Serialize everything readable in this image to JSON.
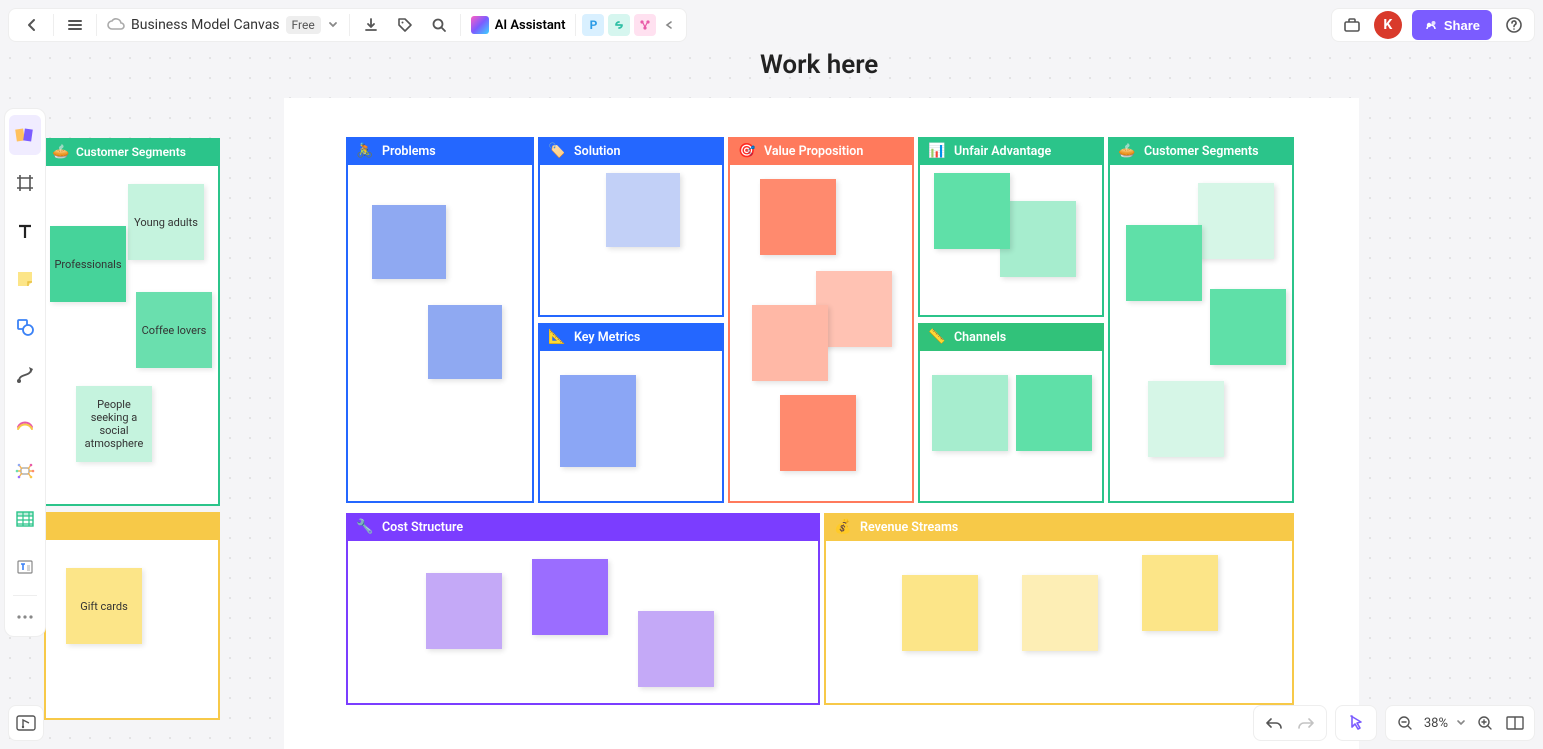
{
  "header": {
    "doc_title": "Business Model Canvas",
    "plan_badge": "Free",
    "ai_assistant_label": "AI Assistant",
    "p_icon_label": "P",
    "avatar_initial": "K",
    "share_label": "Share"
  },
  "canvas": {
    "title": "Work here"
  },
  "left_board": {
    "segments_header": "Customer Segments",
    "notes": {
      "young_adults": "Young adults",
      "professionals": "Professionals",
      "coffee_lovers": "Coffee lovers",
      "social_atmosphere": "People seeking a social atmosphere",
      "gift_cards": "Gift cards"
    }
  },
  "boards": {
    "problems": "Problems",
    "solution": "Solution",
    "key_metrics": "Key Metrics",
    "value_proposition": "Value Proposition",
    "unfair_advantage": "Unfair Advantage",
    "channels": "Channels",
    "customer_segments": "Customer Segments",
    "cost_structure": "Cost Structure",
    "revenue_streams": "Revenue Streams"
  },
  "bottombar": {
    "zoom": "38%"
  }
}
